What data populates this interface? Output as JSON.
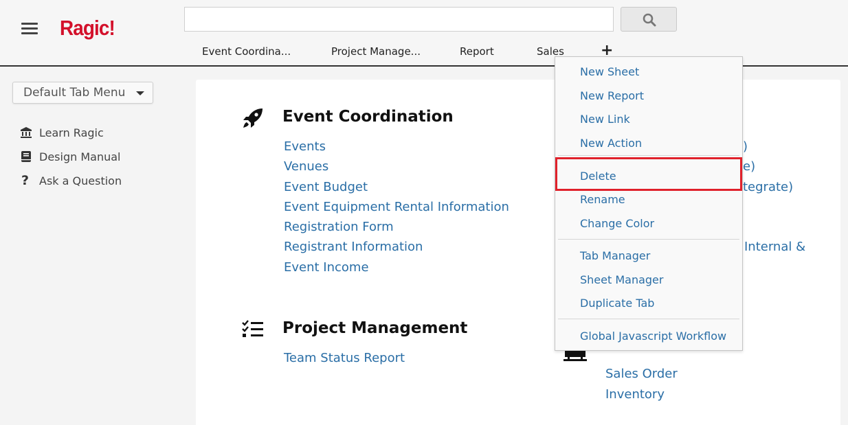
{
  "app": {
    "logo": "Ragic!"
  },
  "search": {
    "placeholder": ""
  },
  "tabs": [
    {
      "label": "Event Coordina..."
    },
    {
      "label": "Project Manage..."
    },
    {
      "label": "Report"
    },
    {
      "label": "Sales"
    }
  ],
  "add_tab_label": "+",
  "sidebar": {
    "tab_menu_label": "Default Tab Menu",
    "links": [
      {
        "label": "Learn Ragic",
        "icon": "bank-icon"
      },
      {
        "label": "Design Manual",
        "icon": "book-icon"
      },
      {
        "label": "Ask a Question",
        "icon": "question-icon"
      }
    ]
  },
  "sections": {
    "event_coordination": {
      "title": "Event Coordination",
      "icon": "rocket-icon",
      "links": [
        "Events",
        "Venues",
        "Event Budget",
        "Event Equipment Rental Information",
        "Registration Form",
        "Registrant Information",
        "Event Income"
      ]
    },
    "project_management": {
      "title": "Project Management",
      "icon": "tasks-icon",
      "links": [
        "Team Status Report"
      ]
    },
    "right_column": {
      "partial_texts": [
        ")",
        "e)",
        "tegrate)",
        "Internal &"
      ]
    },
    "sales": {
      "icon": "cart-icon",
      "links": [
        "Sales Order",
        "Inventory"
      ]
    }
  },
  "dropdown": {
    "items": [
      {
        "label": "New Sheet"
      },
      {
        "label": "New Report"
      },
      {
        "label": "New Link"
      },
      {
        "label": "New Action"
      },
      {
        "label": "Delete"
      },
      {
        "label": "Rename"
      },
      {
        "label": "Change Color"
      },
      {
        "label": "Tab Manager"
      },
      {
        "label": "Sheet Manager"
      },
      {
        "label": "Duplicate Tab"
      },
      {
        "label": "Global Javascript Workflow"
      }
    ]
  },
  "colors": {
    "brand": "#d3112b",
    "link": "#2a6ea6",
    "highlight": "#e0212b"
  }
}
